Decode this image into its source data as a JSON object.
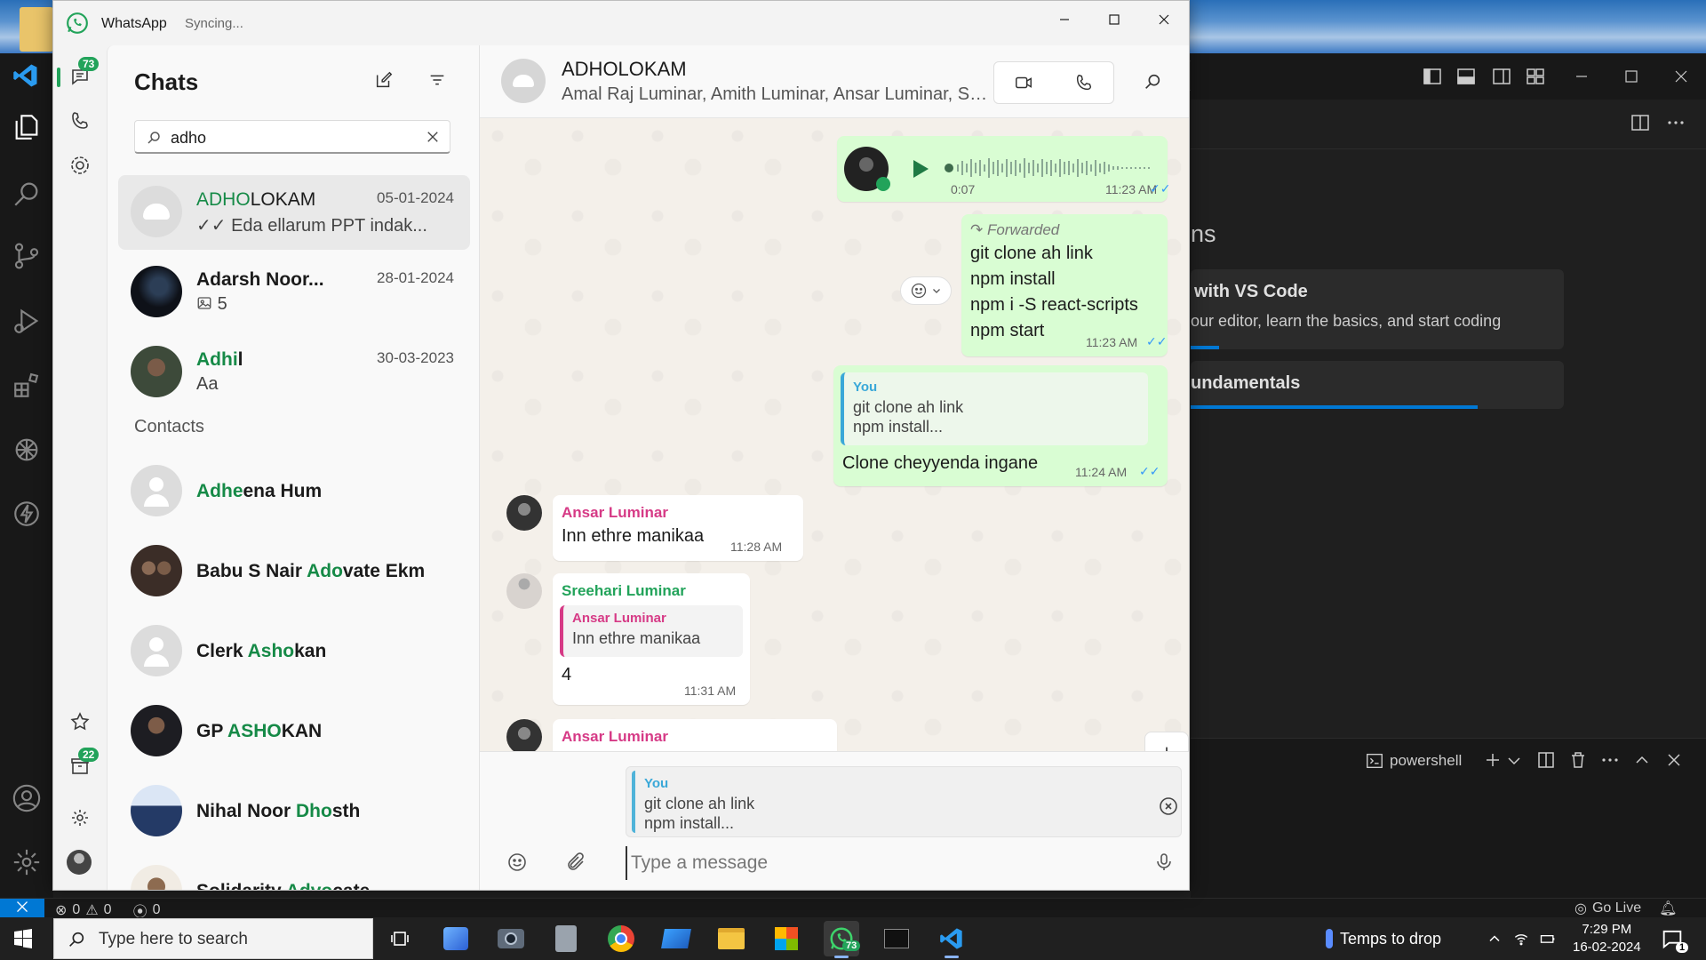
{
  "window": {
    "app_name": "WhatsApp",
    "status": "Syncing..."
  },
  "rail": {
    "chats_badge": "73",
    "archive_badge": "22"
  },
  "chat_list": {
    "title": "Chats",
    "search_value": "adho",
    "chats": [
      {
        "name_highlight": "ADHO",
        "name_rest": "LOKAM",
        "date": "05-01-2024",
        "preview": "✓✓ Eda ellarum PPT indak..."
      },
      {
        "name_highlight": "",
        "name_rest": "Adarsh Noor...",
        "date": "28-01-2024",
        "preview": "5"
      },
      {
        "name_highlight": "Adhi",
        "name_rest": "l",
        "date": "30-03-2023",
        "preview": "Aa"
      }
    ],
    "contacts_header": "Contacts",
    "contacts": [
      {
        "pre": "",
        "highlight": "Adhe",
        "post": "ena Hum"
      },
      {
        "pre": "Babu S Nair ",
        "highlight": "Ado",
        "post": "vate Ekm"
      },
      {
        "pre": "Clerk ",
        "highlight": "Asho",
        "post": "kan"
      },
      {
        "pre": "GP ",
        "highlight": "ASHO",
        "post": "KAN"
      },
      {
        "pre": "Nihal Noor ",
        "highlight": "Dho",
        "post": "sth"
      },
      {
        "pre": "Solidarity ",
        "highlight": "Advo",
        "post": "cate"
      }
    ]
  },
  "chat": {
    "title": "ADHOLOKAM",
    "members": "Amal Raj Luminar, Amith Luminar, Ansar Luminar, Sreehari Luminar, You",
    "messages": {
      "voice": {
        "duration": "0:07",
        "time": "11:23 AM"
      },
      "forwarded": {
        "label": "Forwarded",
        "text": "git clone ah link\nnpm install\nnpm i -S react-scripts\nnpm start",
        "time": "11:23 AM"
      },
      "reply_out": {
        "quote_author": "You",
        "quote_text": "git clone ah link\nnpm install...",
        "text": "Clone cheyyenda ingane",
        "time": "11:24 AM"
      },
      "in1": {
        "sender": "Ansar Luminar",
        "text": "Inn ethre manikaa",
        "time": "11:28 AM"
      },
      "in2": {
        "sender": "Sreehari Luminar",
        "quote_author": "Ansar Luminar",
        "quote_text": "Inn ethre manikaa",
        "text": "4",
        "time": "11:31 AM"
      },
      "in3": {
        "sender": "Ansar Luminar"
      }
    },
    "reply_preview": {
      "author": "You",
      "text": "git clone ah link\nnpm install..."
    },
    "input_placeholder": "Type a message",
    "colors": {
      "outgoing": "#d9fdd3",
      "accent": "#168a47",
      "ansar": "#d63a86",
      "sreehari": "#22a35a",
      "you": "#3aa8d8"
    }
  },
  "vscode": {
    "heading_partial": "ns",
    "card1_title": "with VS Code",
    "card1_desc": "our editor, learn the basics, and start coding",
    "card2_title": "undamentals",
    "terminal_label": "powershell",
    "status_errors": "0",
    "status_warnings": "0",
    "status_ports": "0",
    "golive": "Go Live"
  },
  "taskbar": {
    "search_placeholder": "Type here to search",
    "whatsapp_badge": "73",
    "weather": "Temps to drop",
    "time": "7:29 PM",
    "date": "16-02-2024",
    "notif_badge": "1"
  }
}
